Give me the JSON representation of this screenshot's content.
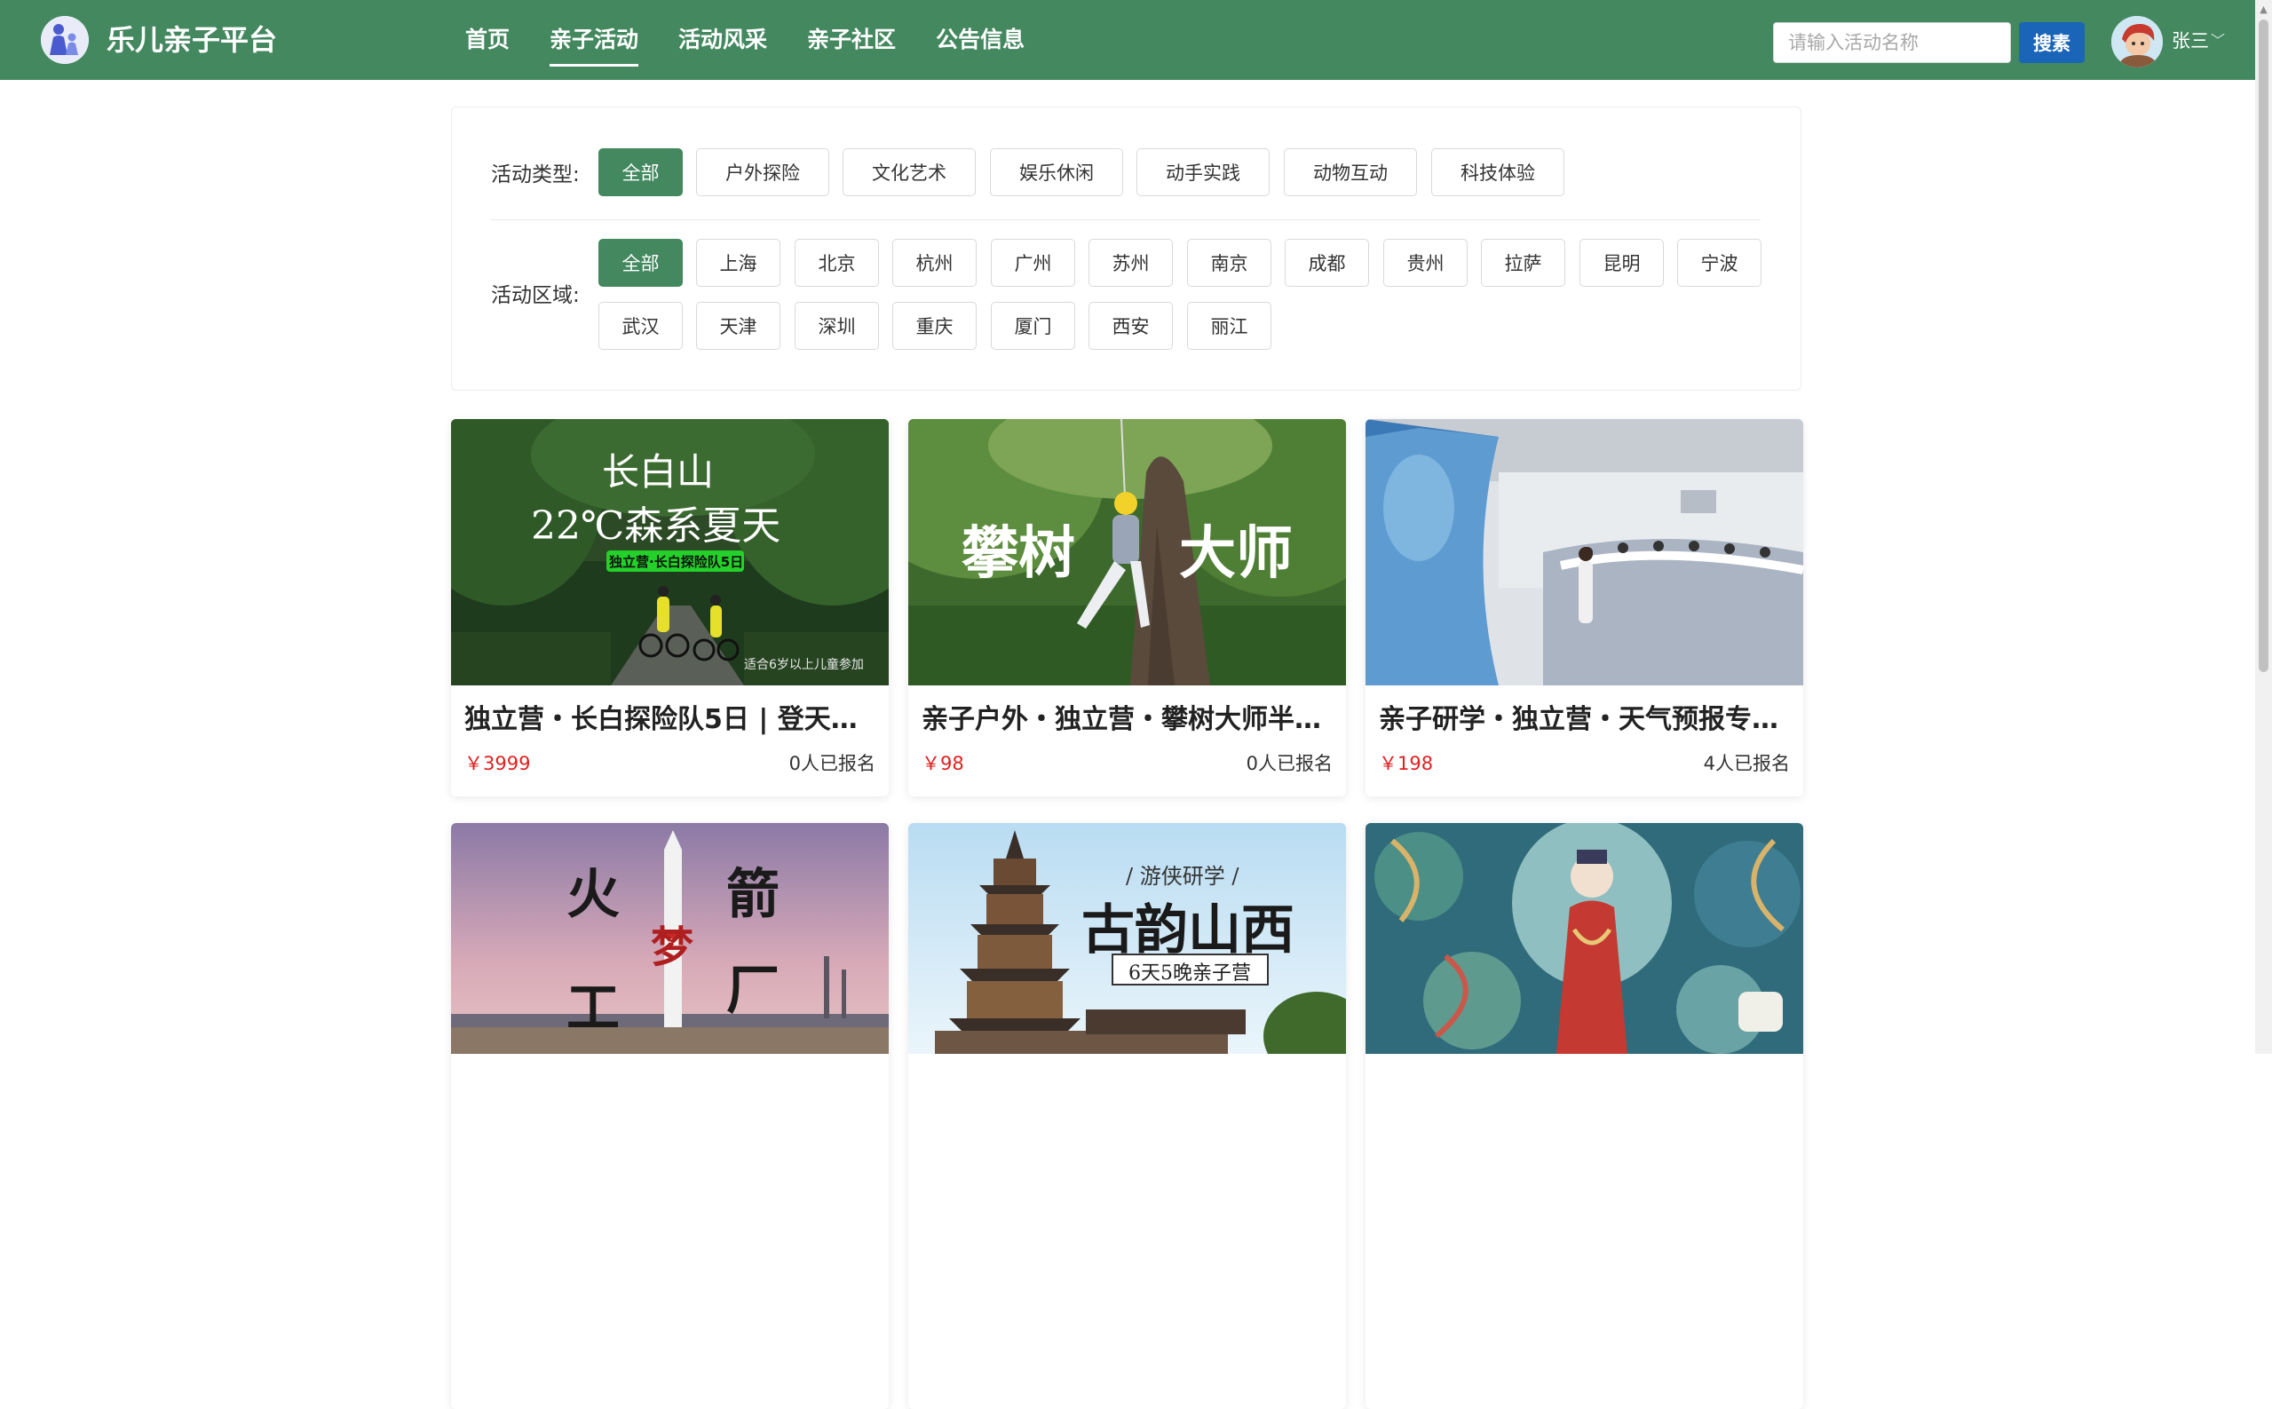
{
  "header": {
    "brand": "乐儿亲子平台",
    "nav": [
      "首页",
      "亲子活动",
      "活动风采",
      "亲子社区",
      "公告信息"
    ],
    "active_nav_index": 1,
    "search_placeholder": "请输入活动名称",
    "search_button": "搜素",
    "username": "张三",
    "caret": "﹀"
  },
  "filters": {
    "type_label": "活动类型:",
    "types": [
      "全部",
      "户外探险",
      "文化艺术",
      "娱乐休闲",
      "动手实践",
      "动物互动",
      "科技体验"
    ],
    "region_label": "活动区域:",
    "regions": [
      "全部",
      "上海",
      "北京",
      "杭州",
      "广州",
      "苏州",
      "南京",
      "成都",
      "贵州",
      "拉萨",
      "昆明",
      "宁波",
      "武汉",
      "天津",
      "深圳",
      "重庆",
      "厦门",
      "西安",
      "丽江"
    ]
  },
  "activities": [
    {
      "title": "独立营・长白探险队5日 | 登天池…",
      "price": "￥3999",
      "signups": "0人已报名",
      "image_texts": {
        "main": "长白山",
        "sub": "22℃森系夏天",
        "badge": "独立营·长白探险队5日",
        "note": "适合6岁以上儿童参加"
      }
    },
    {
      "title": "亲子户外・独立营・攀树大师半…",
      "price": "￥98",
      "signups": "0人已报名",
      "image_texts": {
        "left": "攀树",
        "right": "大师"
      }
    },
    {
      "title": "亲子研学・独立营・天气预报专…",
      "price": "￥198",
      "signups": "4人已报名",
      "image_texts": {}
    },
    {
      "image_texts": {
        "a": "火",
        "b": "箭",
        "c": "梦",
        "d": "工",
        "e": "厂"
      }
    },
    {
      "image_texts": {
        "top": "/ 游侠研学 /",
        "main": "古韵山西",
        "badge": "6天5晚亲子营"
      }
    },
    {
      "image_texts": {}
    }
  ],
  "colors": {
    "brand_green": "#43885f",
    "search_blue": "#1a65b7",
    "price_red": "#e02020"
  }
}
